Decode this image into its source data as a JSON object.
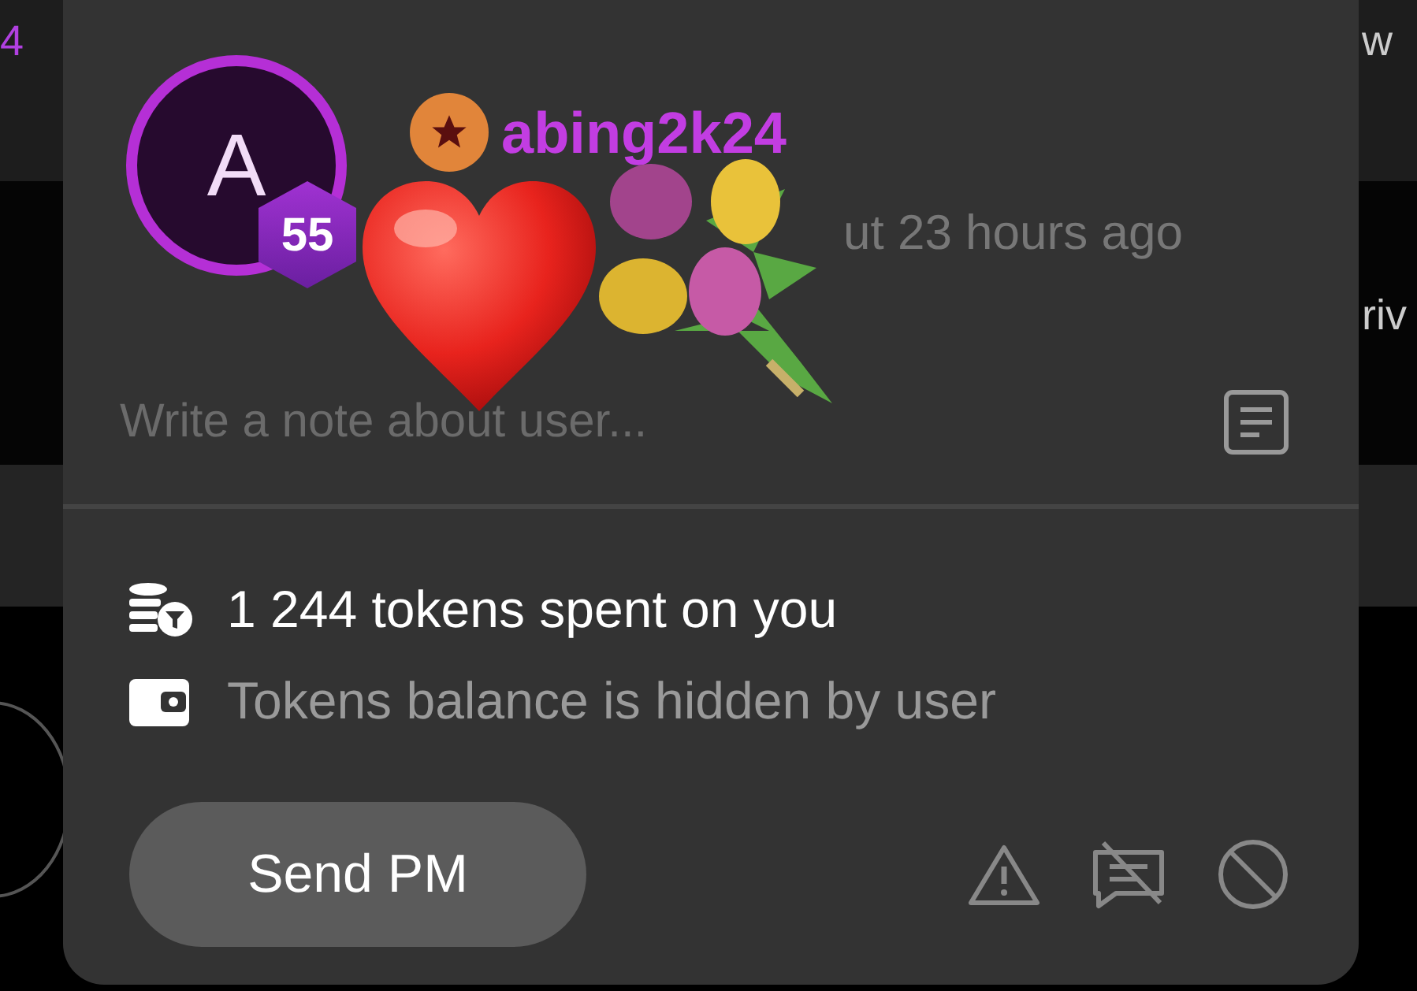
{
  "page_behind": {
    "left_text": "4",
    "right_texts": [
      "w",
      "riv"
    ]
  },
  "popup": {
    "avatar_letter": "A",
    "level_badge": "55",
    "username": "abing2k24",
    "status": "ut 23 hours ago",
    "stickers": [
      {
        "kind": "heart"
      },
      {
        "kind": "bouquet"
      }
    ],
    "note": {
      "placeholder": "Write a note about user..."
    },
    "stats": [
      {
        "kind": "spent",
        "text": "1 244 tokens spent on you"
      },
      {
        "kind": "balance",
        "text": "Tokens balance is hidden by user"
      }
    ],
    "send_button": "Send PM",
    "actions": [
      {
        "kind": "report"
      },
      {
        "kind": "mute"
      },
      {
        "kind": "block"
      }
    ]
  }
}
